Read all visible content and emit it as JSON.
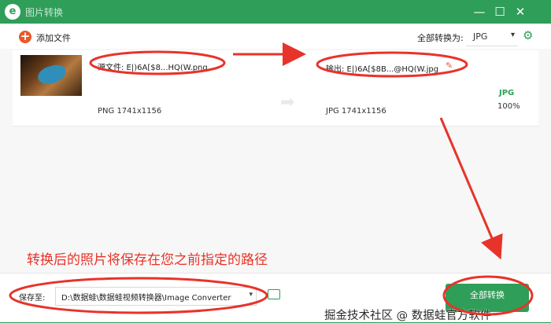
{
  "window": {
    "title": "图片转换",
    "logo_glyph": "e",
    "minimize_glyph": "—",
    "maximize_glyph": "☐",
    "close_glyph": "✕"
  },
  "toolbar": {
    "add_files_icon": "+",
    "add_files_label": "添加文件",
    "convert_all_to_label": "全部转换为:",
    "format_value": "JPG",
    "format_caret": "▾",
    "settings_glyph": "⚙"
  },
  "file": {
    "source_name": "源文件: E|)6A[$8...HQ(W.png",
    "source_meta": "PNG   1741x1156",
    "arrow_glyph": "➡",
    "output_name": "输出: E|)6A[$8B...@HQ(W.jpg",
    "edit_glyph": "✎",
    "output_meta": "JPG   1741x1156",
    "format_badge": "JPG",
    "quality": "100%"
  },
  "annotation": {
    "hint_text": "转换后的照片将保存在您之前指定的路径"
  },
  "bottom": {
    "save_to_label": "保存至:",
    "save_path": "D:\\数据蛙\\数据蛙视频转换器\\Image Converter",
    "path_caret": "▾",
    "convert_all_label": "全部转换",
    "watermark": "掘金技术社区 @ 数据蛙官方软件"
  },
  "colors": {
    "brand_green": "#2f9e58",
    "annotation_red": "#e8332a",
    "accent_orange": "#e9582a"
  }
}
